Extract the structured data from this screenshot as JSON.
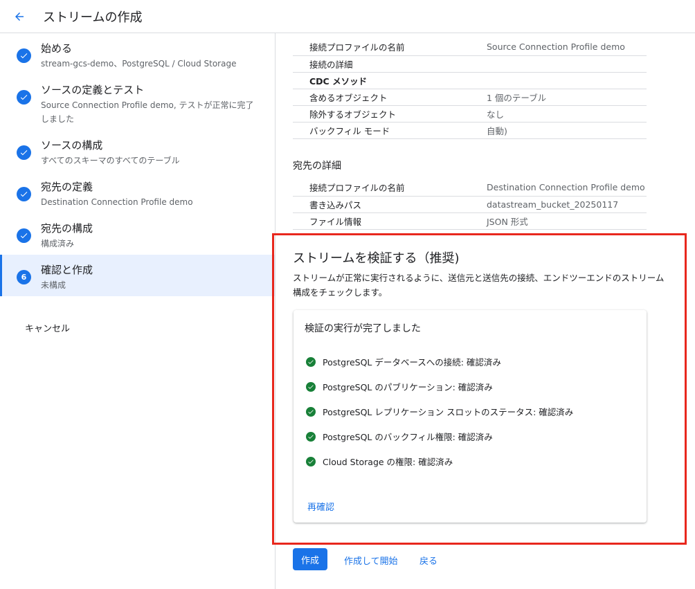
{
  "header": {
    "title": "ストリームの作成"
  },
  "steps": [
    {
      "title": "始める",
      "sub": "stream-gcs-demo、PostgreSQL / Cloud Storage"
    },
    {
      "title": "ソースの定義とテスト",
      "sub": "Source Connection Profile demo, テストが正常に完了しました"
    },
    {
      "title": "ソースの構成",
      "sub": "すべてのスキーマのすべてのテーブル"
    },
    {
      "title": "宛先の定義",
      "sub": "Destination Connection Profile demo"
    },
    {
      "title": "宛先の構成",
      "sub": "構成済み"
    },
    {
      "number": "6",
      "title": "確認と作成",
      "sub": "未構成"
    }
  ],
  "cancel_label": "キャンセル",
  "source_details": [
    {
      "key": "接続プロファイルの名前",
      "value": "Source Connection Profile demo"
    },
    {
      "key": "接続の詳細",
      "value": ""
    },
    {
      "key": "CDC メソッド",
      "value": ""
    },
    {
      "key": "含めるオブジェクト",
      "value": "1 個のテーブル"
    },
    {
      "key": "除外するオブジェクト",
      "value": "なし"
    },
    {
      "key": "バックフィル モード",
      "value": "自動)"
    }
  ],
  "destination": {
    "title": "宛先の詳細",
    "rows": [
      {
        "key": "接続プロファイルの名前",
        "value": "Destination Connection Profile demo"
      },
      {
        "key": "書き込みパス",
        "value": "datastream_bucket_20250117"
      },
      {
        "key": "ファイル情報",
        "value": "JSON 形式"
      }
    ]
  },
  "verify": {
    "title": "ストリームを検証する（推奨)",
    "description": "ストリームが正常に実行されるように、送信元と送信先の接続、エンドツーエンドのストリーム構成をチェックします。",
    "card_title": "検証の実行が完了しました",
    "checks": [
      "PostgreSQL データベースへの接続: 確認済み",
      "PostgreSQL のパブリケーション: 確認済み",
      "PostgreSQL レプリケーション スロットのステータス: 確認済み",
      "PostgreSQL のバックフィル権限: 確認済み",
      "Cloud Storage の権限: 確認済み"
    ],
    "recheck_label": "再確認"
  },
  "actions": {
    "create": "作成",
    "create_and_start": "作成して開始",
    "back": "戻る"
  },
  "colors": {
    "accent": "#1a73e8",
    "success": "#188038",
    "highlight": "#e8271d"
  }
}
